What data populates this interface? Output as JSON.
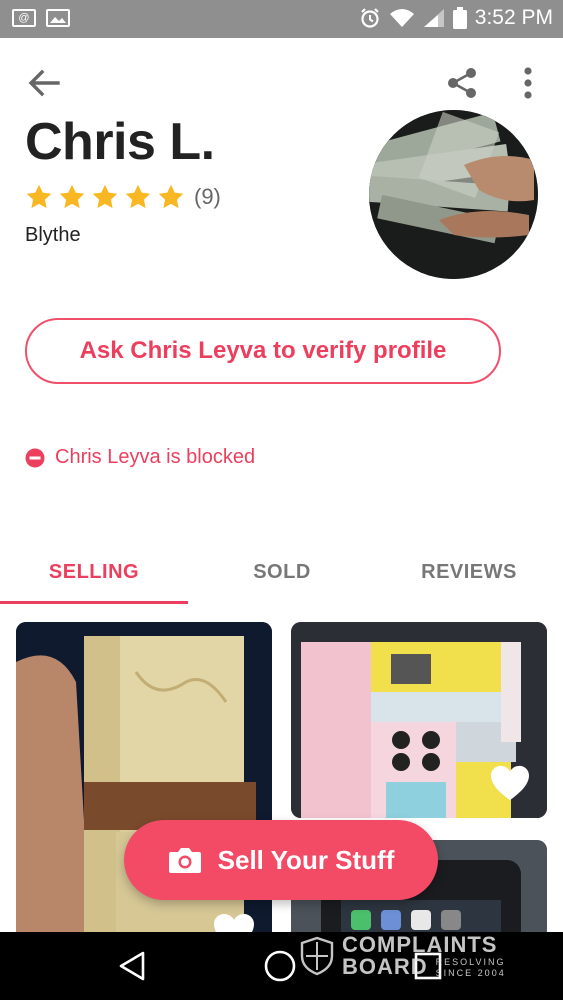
{
  "status_bar": {
    "time": "3:52 PM",
    "left_icons": [
      "at-icon",
      "image-icon"
    ],
    "right_icons": [
      "alarm-icon",
      "wifi-icon",
      "signal-icon",
      "battery-icon"
    ]
  },
  "toolbar": {
    "back_icon": "arrow-left-icon",
    "share_icon": "share-icon",
    "more_icon": "more-vertical-icon"
  },
  "profile": {
    "name": "Chris L.",
    "rating_stars": 5,
    "rating_count": "(9)",
    "location": "Blythe"
  },
  "verify_button": {
    "label": "Ask Chris Leyva to verify profile"
  },
  "blocked_notice": {
    "text": "Chris Leyva is blocked"
  },
  "tabs": [
    {
      "label": "SELLING",
      "active": true
    },
    {
      "label": "SOLD",
      "active": false
    },
    {
      "label": "REVIEWS",
      "active": false
    }
  ],
  "listings": [
    {
      "name": "wallet",
      "favorited": false
    },
    {
      "name": "toy-kitchen",
      "favorited": false
    },
    {
      "name": "phone",
      "favorited": false
    }
  ],
  "fab": {
    "label": "Sell Your Stuff",
    "icon": "camera-icon"
  },
  "watermark": {
    "line1": "COMPLAINTS",
    "line2": "BOARD",
    "tagline1": "RESOLVING",
    "tagline2": "SINCE 2004"
  },
  "colors": {
    "accent": "#ec3f5e",
    "fab": "#f34a66",
    "star": "#f9b823",
    "status_bar": "#8f8f8f"
  }
}
